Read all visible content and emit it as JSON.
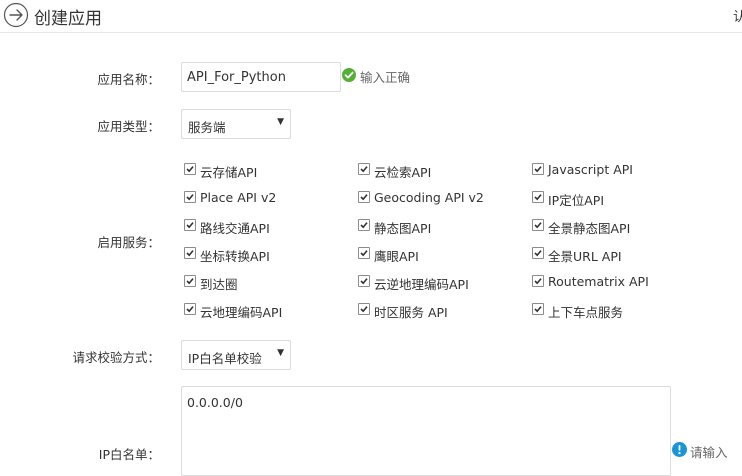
{
  "header": {
    "title": "创建应用",
    "right_text": "认"
  },
  "form": {
    "app_name": {
      "label": "应用名称：",
      "value": "API_For_Python",
      "validation": "输入正确"
    },
    "app_type": {
      "label": "应用类型：",
      "selected": "服务端"
    },
    "services": {
      "label": "启用服务：",
      "items": [
        {
          "label": "云存储API",
          "checked": true
        },
        {
          "label": "云检索API",
          "checked": true
        },
        {
          "label": "Javascript API",
          "checked": true
        },
        {
          "label": "Place API v2",
          "checked": true
        },
        {
          "label": "Geocoding API v2",
          "checked": true
        },
        {
          "label": "IP定位API",
          "checked": true
        },
        {
          "label": "路线交通API",
          "checked": true
        },
        {
          "label": "静态图API",
          "checked": true
        },
        {
          "label": "全景静态图API",
          "checked": true
        },
        {
          "label": "坐标转换API",
          "checked": true
        },
        {
          "label": "鹰眼API",
          "checked": true
        },
        {
          "label": "全景URL API",
          "checked": true
        },
        {
          "label": "到达圈",
          "checked": true
        },
        {
          "label": "云逆地理编码API",
          "checked": true
        },
        {
          "label": "Routematrix API",
          "checked": true
        },
        {
          "label": "云地理编码API",
          "checked": true
        },
        {
          "label": "时区服务 API",
          "checked": true
        },
        {
          "label": "上下车点服务",
          "checked": true
        }
      ]
    },
    "verify_method": {
      "label": "请求校验方式：",
      "selected": "IP白名单校验"
    },
    "ip_whitelist": {
      "label": "IP白名单：",
      "value": "0.0.0.0/0",
      "hint": "请输入"
    }
  },
  "colors": {
    "success": "#52b035",
    "info": "#1a95d8"
  }
}
